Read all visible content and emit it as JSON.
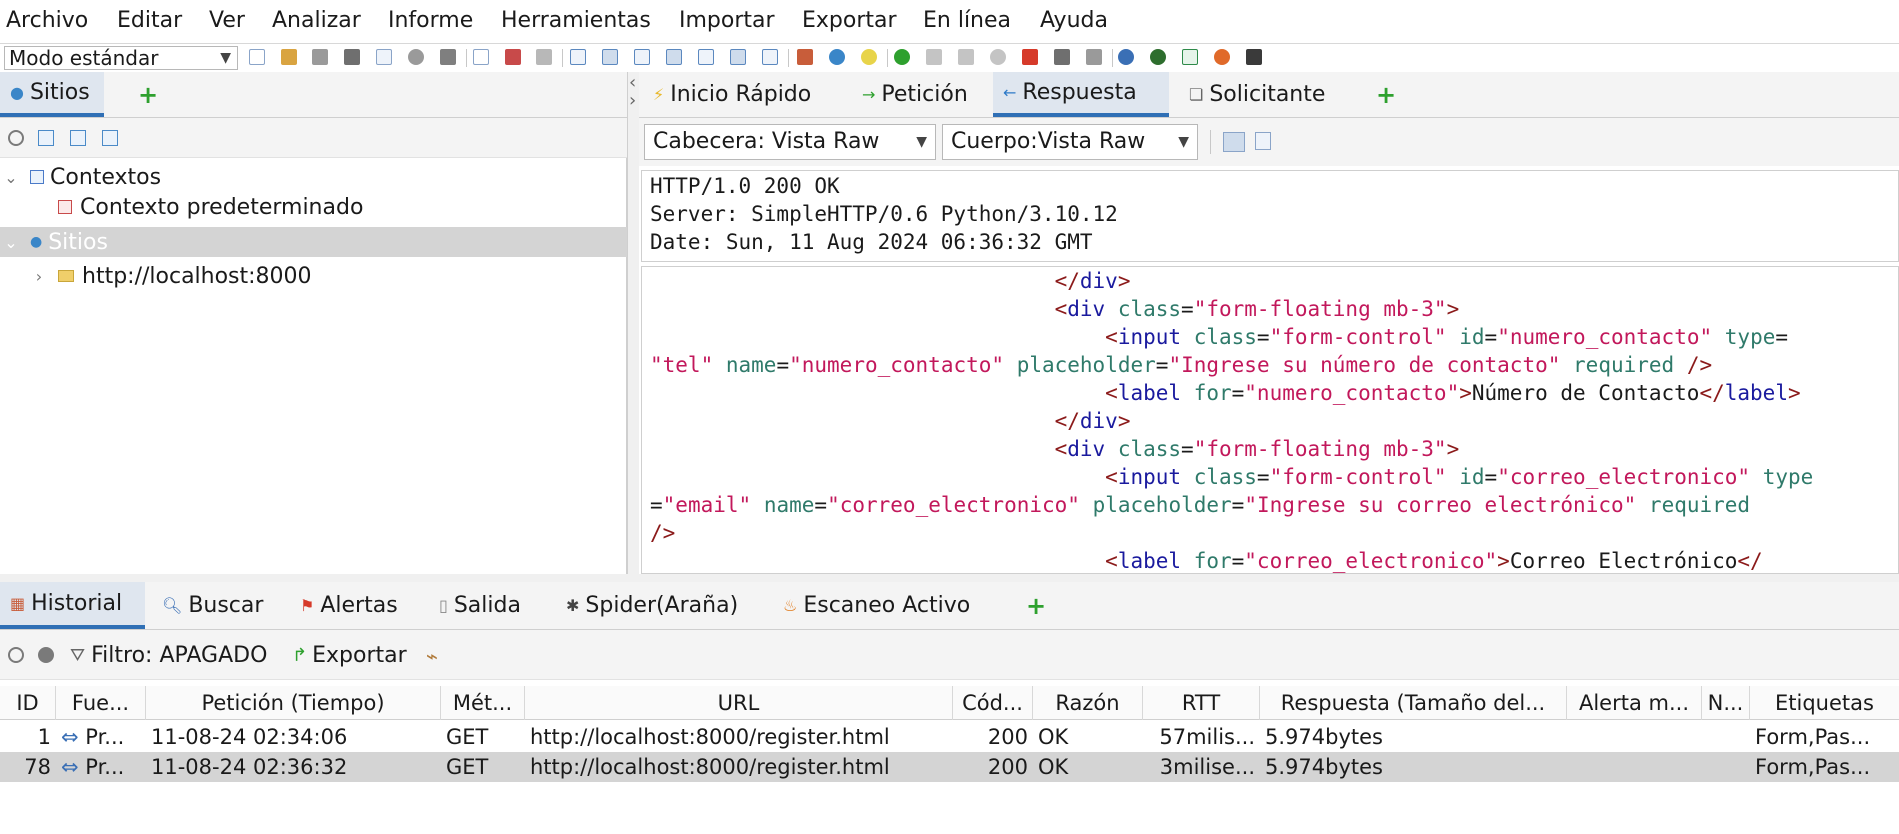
{
  "menu": [
    "Archivo",
    "Editar",
    "Ver",
    "Analizar",
    "Informe",
    "Herramientas",
    "Importar",
    "Exportar",
    "En línea",
    "Ayuda"
  ],
  "toolbar": {
    "mode": "Modo estándar"
  },
  "sites_panel": {
    "tab_label": "Sitios",
    "tree": {
      "contexts": "Contextos",
      "default_context": "Contexto predeterminado",
      "sites": "Sitios",
      "host": "http://localhost:8000"
    }
  },
  "request_tabs": [
    "Inicio Rápido",
    "Petición",
    "Respuesta",
    "Solicitante"
  ],
  "view": {
    "header": "Cabecera: Vista Raw",
    "body": "Cuerpo:Vista Raw"
  },
  "response_header": [
    "HTTP/1.0 200 OK",
    "Server: SimpleHTTP/0.6 Python/3.10.12",
    "Date: Sun, 11 Aug 2024 06:36:32 GMT"
  ],
  "bottom_tabs": [
    "Historial",
    "Buscar",
    "Alertas",
    "Salida",
    "Spider(Araña)",
    "Escaneo Activo"
  ],
  "filter": {
    "label": "Filtro: APAGADO",
    "export": "Exportar"
  },
  "history": {
    "columns": [
      "ID",
      "Fue...",
      "Petición (Tiempo)",
      "Mét...",
      "URL",
      "Cód...",
      "Razón",
      "RTT",
      "Respuesta (Tamaño del...",
      "Alerta m...",
      "N...",
      "Etiquetas"
    ],
    "rows": [
      {
        "id": "1",
        "source": "Pr...",
        "time": "11-08-24 02:34:06",
        "method": "GET",
        "url": "http://localhost:8000/register.html",
        "code": "200",
        "reason": "OK",
        "rtt": "57milis...",
        "size": "5.974bytes",
        "alert": "",
        "notes": "",
        "tags": "Form,Pas..."
      },
      {
        "id": "78",
        "source": "Pr...",
        "time": "11-08-24 02:36:32",
        "method": "GET",
        "url": "http://localhost:8000/register.html",
        "code": "200",
        "reason": "OK",
        "rtt": "3milise...",
        "size": "5.974bytes",
        "alert": "",
        "notes": "",
        "tags": "Form,Pas..."
      }
    ]
  },
  "icons": {
    "sites": "globe-icon",
    "add": "plus-icon",
    "quickstart": "lightning-icon",
    "request": "arrow-right-icon",
    "response": "arrow-left-icon",
    "requester": "requester-icon",
    "history": "history-icon",
    "search": "search-icon",
    "alerts": "flag-icon",
    "output": "document-icon",
    "spider": "spider-icon",
    "active_scan": "flame-icon"
  },
  "colors": {
    "accent": "#2f6fb5",
    "add": "#2ea02e",
    "tag": "#8b1a1a",
    "tag_name": "#1a1a9e",
    "attr_name": "#2f7a6a",
    "attr_value": "#c2185b"
  }
}
